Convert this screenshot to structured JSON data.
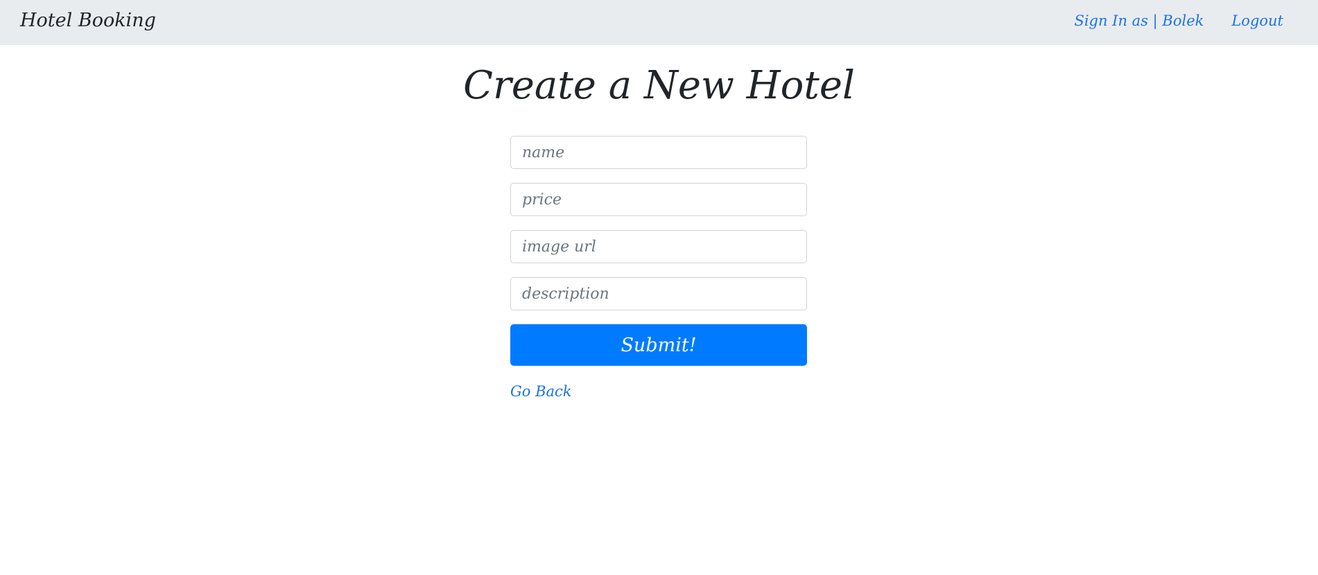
{
  "navbar": {
    "brand": "Hotel Booking",
    "sign_in_label": "Sign In as | Bolek",
    "logout_label": "Logout"
  },
  "main": {
    "title": "Create a New Hotel",
    "form": {
      "name_placeholder": "name",
      "price_placeholder": "price",
      "image_url_placeholder": "image url",
      "description_placeholder": "description",
      "name_value": "",
      "price_value": "",
      "image_url_value": "",
      "description_value": "",
      "submit_label": "Submit!"
    },
    "go_back_label": "Go Back"
  },
  "colors": {
    "navbar_bg": "#e9ecef",
    "link": "#1a73e8",
    "primary_button": "#007bff",
    "text": "#212529"
  }
}
